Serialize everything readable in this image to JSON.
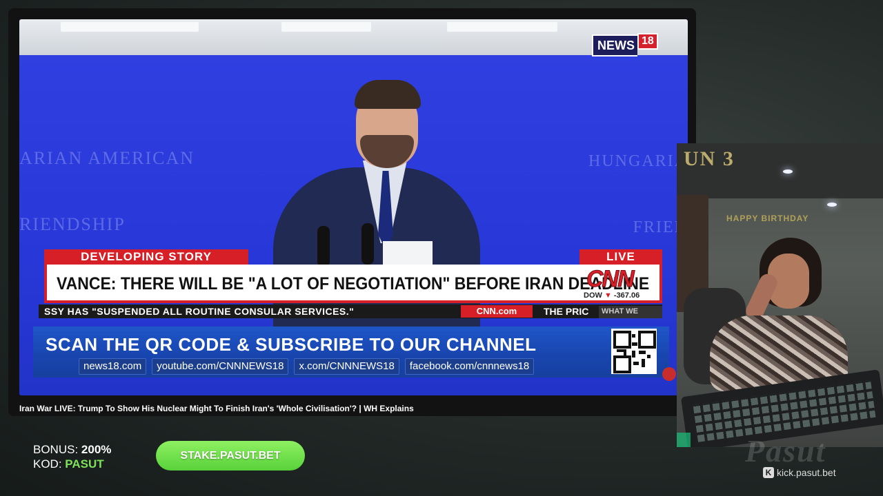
{
  "video": {
    "network_logo": {
      "name": "NEWS",
      "number": "18"
    },
    "backdrop_text_left_line1": "ARIAN AMERICAN",
    "backdrop_text_left_line2": "RIENDSHIP",
    "backdrop_text_right_line1": "HUNGARIA",
    "backdrop_text_right_line2": "FRIEN",
    "chyron": {
      "label": "DEVELOPING STORY",
      "live": "LIVE",
      "headline": "VANCE: THERE WILL BE \"A LOT OF NEGOTIATION\" BEFORE IRAN DEADLINE",
      "logo": "CNN",
      "dow_label": "DOW",
      "dow_arrow": "▼",
      "dow_value": "-367.06",
      "ticker": "SSY HAS \"SUSPENDED ALL ROUTINE CONSULAR SERVICES.\"",
      "ticker_site": "CNN.com",
      "ticker_next": "THE PRIC",
      "what_we_know": "WHAT WE KNOW"
    },
    "subscribe": {
      "title": "SCAN THE QR CODE & SUBSCRIBE TO OUR CHANNEL",
      "links": [
        "news18.com",
        "youtube.com/CNNNEWS18",
        "x.com/CNNNEWS18",
        "facebook.com/cnnnews18"
      ]
    },
    "title": "Iran War LIVE: Trump To Show His Nuclear Might To Finish Iran's 'Whole Civilisation'? | WH Explains"
  },
  "webcam": {
    "sign": "UN 3",
    "banner": "HAPPY BIRTHDAY"
  },
  "overlay": {
    "bonus_label": "BONUS:",
    "bonus_value": "200%",
    "kod_label": "KOD:",
    "kod_value": "PASUT",
    "button_label": "STAKE.PASUT.BET",
    "brand_signature": "Pasut",
    "kick_icon": "K",
    "kick_link": "kick.pasut.bet"
  },
  "colors": {
    "cnn_red": "#d61f26",
    "backdrop_blue": "#2838d8",
    "banner_blue": "#1846b0",
    "button_green": "#58d23a",
    "kod_green": "#7ee25a"
  }
}
